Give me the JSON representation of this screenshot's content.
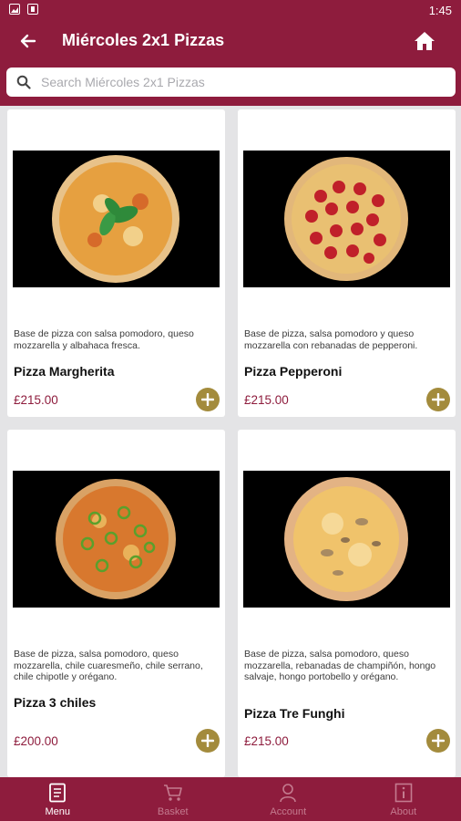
{
  "status_bar": {
    "time": "1:45"
  },
  "header": {
    "title": "Miércoles 2x1 Pizzas"
  },
  "search": {
    "placeholder": "Search Miércoles 2x1 Pizzas"
  },
  "products": [
    {
      "description": "Base de pizza con salsa pomodoro, queso mozzarella y albahaca fresca.",
      "name": "Pizza Margherita",
      "price": "£215.00"
    },
    {
      "description": "Base de pizza, salsa pomodoro y queso mozzarella con rebanadas de pepperoni.",
      "name": "Pizza Pepperoni",
      "price": "£215.00"
    },
    {
      "description": "Base de pizza, salsa pomodoro, queso mozzarella, chile cuaresmeño, chile serrano, chile chipotle y orégano.",
      "name": "Pizza 3 chiles",
      "price": "£200.00"
    },
    {
      "description": "Base de pizza, salsa pomodoro, queso mozzarella, rebanadas de champiñón, hongo salvaje, hongo portobello y orégano.",
      "name": "Pizza Tre Funghi",
      "price": "£215.00"
    }
  ],
  "tabs": [
    {
      "label": "Menu",
      "icon": "menu-book-icon",
      "active": true
    },
    {
      "label": "Basket",
      "icon": "cart-icon",
      "active": false
    },
    {
      "label": "Account",
      "icon": "person-icon",
      "active": false
    },
    {
      "label": "About",
      "icon": "info-icon",
      "active": false
    }
  ],
  "colors": {
    "brand": "#8e1c3d",
    "add_button": "#a38b3c",
    "price": "#8e1c3d",
    "background": "#e4e4e6"
  }
}
